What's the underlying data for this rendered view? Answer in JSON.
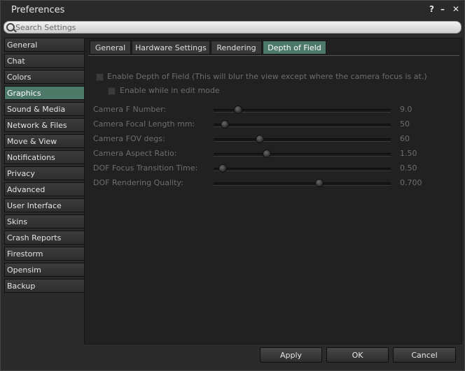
{
  "window": {
    "title": "Preferences",
    "help_glyph": "?",
    "minimize_glyph": "–",
    "close_glyph": "✕"
  },
  "search": {
    "placeholder": "Search Settings",
    "value": ""
  },
  "sidebar": {
    "items": [
      {
        "label": "General",
        "active": false
      },
      {
        "label": "Chat",
        "active": false
      },
      {
        "label": "Colors",
        "active": false
      },
      {
        "label": "Graphics",
        "active": true
      },
      {
        "label": "Sound & Media",
        "active": false
      },
      {
        "label": "Network & Files",
        "active": false
      },
      {
        "label": "Move & View",
        "active": false
      },
      {
        "label": "Notifications",
        "active": false
      },
      {
        "label": "Privacy",
        "active": false
      },
      {
        "label": "Advanced",
        "active": false
      },
      {
        "label": "User Interface",
        "active": false
      },
      {
        "label": "Skins",
        "active": false
      },
      {
        "label": "Crash Reports",
        "active": false
      },
      {
        "label": "Firestorm",
        "active": false
      },
      {
        "label": "Opensim",
        "active": false
      },
      {
        "label": "Backup",
        "active": false
      }
    ]
  },
  "tabs": [
    {
      "label": "General",
      "active": false
    },
    {
      "label": "Hardware Settings",
      "active": false
    },
    {
      "label": "Rendering",
      "active": false
    },
    {
      "label": "Depth of Field",
      "active": true
    }
  ],
  "dof": {
    "enable_label": "Enable Depth of Field (This will blur the view except where the camera focus is at.)",
    "enable_checked": false,
    "edit_mode_label": "Enable while in edit mode",
    "edit_mode_checked": false
  },
  "sliders": [
    {
      "label": "Camera F Number:",
      "value": "9.0",
      "fraction": 0.12
    },
    {
      "label": "Camera Focal Length mm:",
      "value": "50",
      "fraction": 0.04
    },
    {
      "label": "Camera FOV degs:",
      "value": "60",
      "fraction": 0.25
    },
    {
      "label": "Camera Aspect Ratio:",
      "value": "1.50",
      "fraction": 0.29
    },
    {
      "label": "DOF Focus Transition Time:",
      "value": "0.50",
      "fraction": 0.03
    },
    {
      "label": "DOF Rendering Quality:",
      "value": "0.700",
      "fraction": 0.6
    }
  ],
  "footer": {
    "apply_label": "Apply",
    "ok_label": "OK",
    "cancel_label": "Cancel"
  },
  "colors": {
    "accent": "#4d7968",
    "panel": "#212121",
    "disabled_text": "#6e6e6e"
  }
}
